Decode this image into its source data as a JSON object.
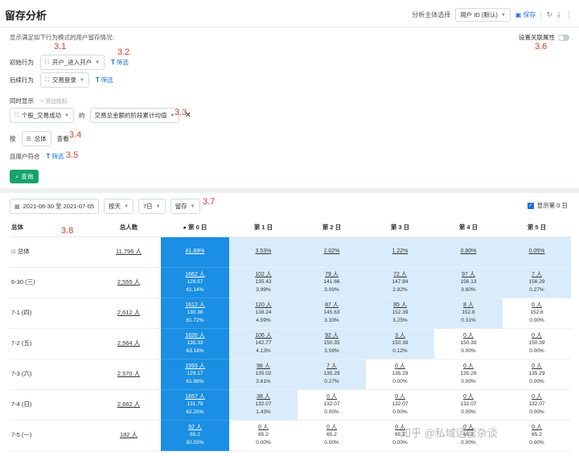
{
  "header": {
    "title": "留存分析",
    "subject_label": "分析主体选择",
    "subject_value": "用户 ID (默认)",
    "save_label": "保存"
  },
  "filters": {
    "description": "显示满足如下行为模式的用户留存情况:",
    "annotations": {
      "a31": "3.1",
      "a32": "3.2",
      "a33": "3.3",
      "a34": "3.4",
      "a35": "3.5",
      "a36": "3.6",
      "a37": "3.7",
      "a38": "3.8"
    },
    "link_attr_label": "设置关联属性",
    "initial": {
      "label": "初始行为",
      "event": "开户_进入开户",
      "filter": "筛选"
    },
    "return": {
      "label": "后续行为",
      "event": "交易登录",
      "filter": "筛选"
    },
    "simultaneous": {
      "label": "同时显示",
      "add": "+ 添加指标",
      "event": "个股_交易成功",
      "of": "的",
      "metric": "交易总金额的阶段累计均值"
    },
    "group": {
      "by": "按",
      "dim": "总体",
      "view": "查看"
    },
    "user": {
      "label": "且用户符合",
      "filter": "筛选"
    },
    "run_label": "查询"
  },
  "toolbar": {
    "date_range": "2021-06-30 至 2021-07-05",
    "unit": "按天",
    "window": "7日",
    "type": "留存",
    "show_day0": "显示第 0 日"
  },
  "table": {
    "headers": [
      "总体",
      "总人数",
      "第 0 日",
      "第 1 日",
      "第 2 日",
      "第 3 日",
      "第 4 日",
      "第 5 日"
    ],
    "total_row": {
      "label": "总体",
      "total": "11,796 人",
      "cells": [
        "61.69%",
        "3.53%",
        "2.02%",
        "1.22%",
        "0.80%",
        "0.05%"
      ]
    },
    "rows": [
      {
        "label": "6-30 (三)",
        "total": "2,555 人",
        "cells": [
          [
            "1662 人",
            "128.57",
            "61.14%"
          ],
          [
            "102 人",
            "135.43",
            "3.99%"
          ],
          [
            "79 人",
            "141.66",
            "3.09%"
          ],
          [
            "72 人",
            "147.84",
            "2.82%"
          ],
          [
            "97 人",
            "156.13",
            "3.80%"
          ],
          [
            "7 人",
            "156.29",
            "0.27%"
          ]
        ]
      },
      {
        "label": "7-1 (四)",
        "total": "2,612 人",
        "cells": [
          [
            "1612 人",
            "130.38",
            "61.72%"
          ],
          [
            "120 人",
            "138.24",
            "4.59%"
          ],
          [
            "87 人",
            "145.63",
            "3.33%"
          ],
          [
            "85 人",
            "152.39",
            "3.25%"
          ],
          [
            "8 人",
            "152.8",
            "0.31%"
          ],
          [
            "0 人",
            "152.8",
            "0.00%"
          ]
        ]
      },
      {
        "label": "7-2 (五)",
        "total": "2,564 人",
        "cells": [
          [
            "1620 人",
            "135.33",
            "63.18%"
          ],
          [
            "106 人",
            "142.77",
            "4.13%"
          ],
          [
            "92 人",
            "150.35",
            "3.59%"
          ],
          [
            "3 人",
            "150.39",
            "0.12%"
          ],
          [
            "0 人",
            "150.39",
            "0.00%"
          ],
          [
            "0 人",
            "150.39",
            "0.00%"
          ]
        ]
      },
      {
        "label": "7-3 (六)",
        "total": "2,570 人",
        "cells": [
          [
            "1593 人",
            "129.17",
            "61.98%"
          ],
          [
            "98 人",
            "135.02",
            "3.81%"
          ],
          [
            "7 人",
            "135.29",
            "0.27%"
          ],
          [
            "0 人",
            "135.29",
            "0.00%"
          ],
          [
            "0 人",
            "135.29",
            "0.00%"
          ],
          [
            "0 人",
            "135.29",
            "0.00%"
          ]
        ]
      },
      {
        "label": "7-4 (日)",
        "total": "2,662 人",
        "cells": [
          [
            "1657 人",
            "131.78",
            "62.25%"
          ],
          [
            "38 人",
            "132.07",
            "1.43%"
          ],
          [
            "0 人",
            "132.07",
            "0.00%"
          ],
          [
            "0 人",
            "132.07",
            "0.00%"
          ],
          [
            "0 人",
            "132.07",
            "0.00%"
          ],
          [
            "0 人",
            "132.07",
            "0.00%"
          ]
        ]
      },
      {
        "label": "7-5 (一)",
        "total": "182 人",
        "cells": [
          [
            "92 人",
            "65.2",
            "50.55%"
          ],
          [
            "0 人",
            "65.2",
            "0.00%"
          ],
          [
            "0 人",
            "65.2",
            "0.00%"
          ],
          [
            "0 人",
            "65.2",
            "0.00%"
          ],
          [
            "0 人",
            "65.2",
            "0.00%"
          ],
          [
            "0 人",
            "65.2",
            "0.00%"
          ]
        ]
      }
    ],
    "shade": [
      [
        "dk",
        "lt",
        "lt",
        "lt",
        "lt",
        "lt"
      ],
      [
        "dk",
        "lt",
        "lt",
        "lt",
        "lt",
        "lt"
      ],
      [
        "dk",
        "lt",
        "lt",
        "lt",
        "lt",
        "wh"
      ],
      [
        "dk",
        "lt",
        "lt",
        "lt",
        "wh",
        "wh"
      ],
      [
        "dk",
        "lt",
        "lt",
        "wh",
        "wh",
        "wh"
      ],
      [
        "dk",
        "lt",
        "wh",
        "wh",
        "wh",
        "wh"
      ],
      [
        "dk",
        "wh",
        "wh",
        "wh",
        "wh",
        "wh"
      ]
    ]
  },
  "watermark": "知乎 @私域运营杂谈"
}
